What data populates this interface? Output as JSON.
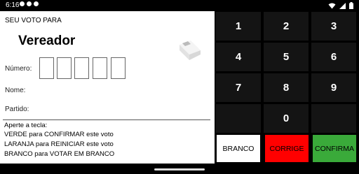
{
  "status": {
    "time": "6:16",
    "left_icons": [
      "notification-dot-icon",
      "notification-dot-icon",
      "notification-dot-icon"
    ],
    "right_icons": [
      "wifi-icon",
      "signal-icon",
      "battery-icon"
    ]
  },
  "header": {
    "subtitle": "SEU VOTO PARA",
    "role": "Vereador"
  },
  "fields": {
    "numero_label": "Número:",
    "nome_label": "Nome:",
    "partido_label": "Partido:",
    "digits": [
      "",
      "",
      "",
      "",
      ""
    ]
  },
  "instructions": {
    "line1": "Aperte a tecla:",
    "line2": "VERDE para CONFIRMAR este voto",
    "line3": "LARANJA para REINICIAR este voto",
    "line4": "BRANCO para VOTAR EM BRANCO"
  },
  "keypad": {
    "keys": [
      "1",
      "2",
      "3",
      "4",
      "5",
      "6",
      "7",
      "8",
      "9",
      "0"
    ]
  },
  "actions": {
    "branco": "BRANCO",
    "corrige": "CORRIGE",
    "confirma": "CONFIRMA"
  },
  "colors": {
    "branco_bg": "#ffffff",
    "corrige_bg": "#ff0000",
    "confirma_bg": "#3aaa3a"
  }
}
